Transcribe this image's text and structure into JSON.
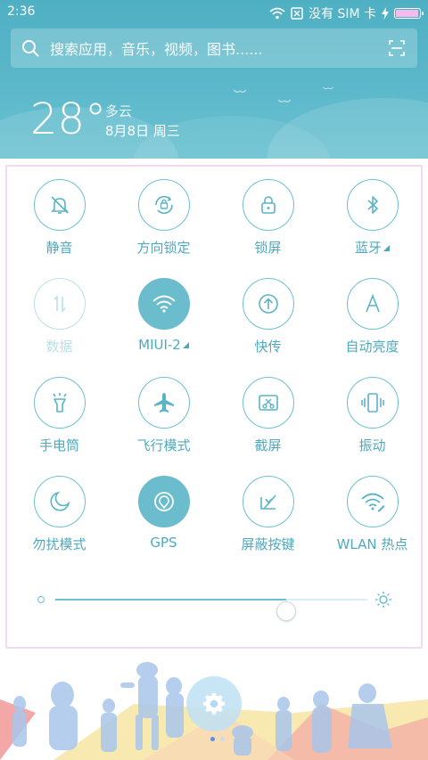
{
  "status_bar": {
    "time": "2:36",
    "carrier": "没有 SIM 卡",
    "battery_level": 0.95,
    "battery_color": "#f6b9f0"
  },
  "search": {
    "placeholder": "搜索应用，音乐，视频，图书......"
  },
  "weather": {
    "temperature": "28°",
    "condition": "多云",
    "date": "8月8日 周三"
  },
  "toggles": [
    {
      "label": "静音",
      "icon": "bell-off-icon",
      "state": "off"
    },
    {
      "label": "方向锁定",
      "icon": "rotation-lock-icon",
      "state": "off"
    },
    {
      "label": "锁屏",
      "icon": "lock-icon",
      "state": "off"
    },
    {
      "label": "蓝牙",
      "icon": "bluetooth-icon",
      "state": "off",
      "has_more": true
    },
    {
      "label": "数据",
      "icon": "mobile-data-icon",
      "state": "disabled"
    },
    {
      "label": "MIUI-2",
      "icon": "wifi-icon",
      "state": "on",
      "has_more": true
    },
    {
      "label": "快传",
      "icon": "fast-transfer-icon",
      "state": "off"
    },
    {
      "label": "自动亮度",
      "icon": "auto-brightness-icon",
      "state": "off"
    },
    {
      "label": "手电筒",
      "icon": "flashlight-icon",
      "state": "off"
    },
    {
      "label": "飞行模式",
      "icon": "airplane-icon",
      "state": "off"
    },
    {
      "label": "截屏",
      "icon": "screenshot-icon",
      "state": "off"
    },
    {
      "label": "振动",
      "icon": "vibrate-icon",
      "state": "off"
    },
    {
      "label": "勿扰模式",
      "icon": "moon-icon",
      "state": "off"
    },
    {
      "label": "GPS",
      "icon": "gps-icon",
      "state": "on"
    },
    {
      "label": "屏蔽按键",
      "icon": "block-keys-icon",
      "state": "off"
    },
    {
      "label": "WLAN 热点",
      "icon": "hotspot-icon",
      "state": "off"
    }
  ],
  "brightness": {
    "level": 0.74
  },
  "colors": {
    "accent": "#6bbccd",
    "header_bg": "#56b4c7",
    "panel_border": "#f2d9f2"
  },
  "dock": {
    "settings_icon": "gear-icon",
    "pages": 2,
    "active_page": 1
  }
}
